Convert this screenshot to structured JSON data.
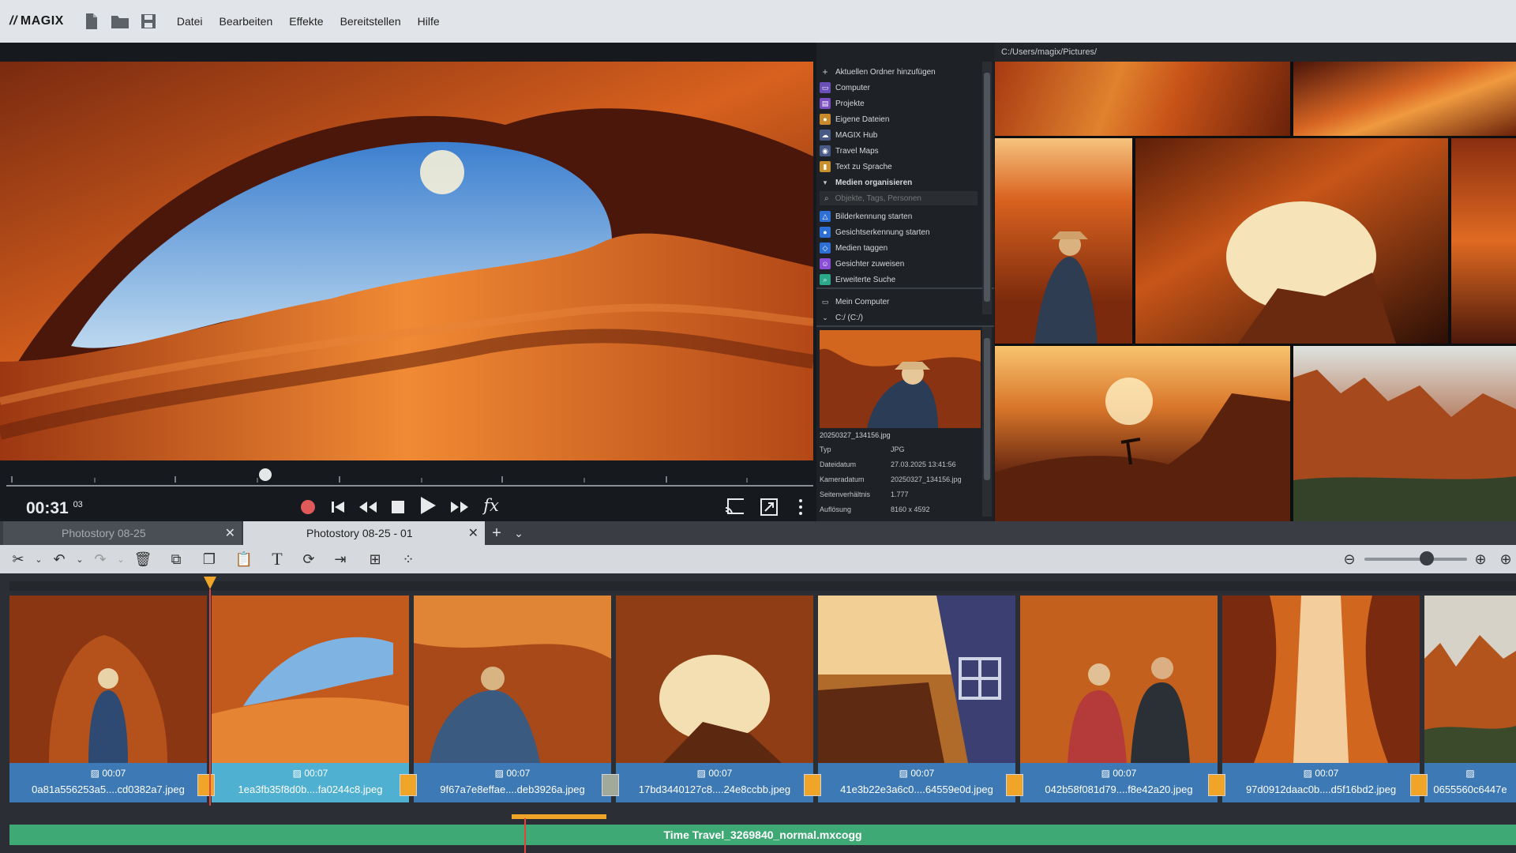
{
  "app": {
    "logo": "MAGIX"
  },
  "menu": [
    "Datei",
    "Bearbeiten",
    "Effekte",
    "Bereitstellen",
    "Hilfe"
  ],
  "player": {
    "time": "00:31",
    "frames": "03",
    "fx_label": "fx"
  },
  "browser": {
    "path": "C:/Users/magix/Pictures/",
    "items": [
      {
        "label": "Aktuellen Ordner hinzufügen",
        "icon": "plus-icon"
      },
      {
        "label": "Computer",
        "icon": "computer-icon"
      },
      {
        "label": "Projekte",
        "icon": "projects-icon"
      },
      {
        "label": "Eigene Dateien",
        "icon": "user-files-icon"
      },
      {
        "label": "MAGIX Hub",
        "icon": "cloud-icon"
      },
      {
        "label": "Travel Maps",
        "icon": "map-pin-icon"
      },
      {
        "label": "Text zu Sprache",
        "icon": "speech-icon"
      },
      {
        "label": "Medien organisieren",
        "icon": "chevron-down-icon"
      }
    ],
    "search_placeholder": "Objekte, Tags, Personen",
    "actions": [
      {
        "label": "Bilderkennung starten",
        "icon": "image-recognition-icon",
        "color": "#2e6fd6"
      },
      {
        "label": "Gesichtserkennung starten",
        "icon": "face-recognition-icon",
        "color": "#2e6fd6"
      },
      {
        "label": "Medien taggen",
        "icon": "tag-icon",
        "color": "#2e6fd6"
      },
      {
        "label": "Gesichter zuweisen",
        "icon": "assign-faces-icon",
        "color": "#8a4fd6"
      },
      {
        "label": "Erweiterte Suche",
        "icon": "advanced-search-icon",
        "color": "#2aa889"
      }
    ],
    "tree": {
      "mycomputer": "Mein Computer",
      "drive": "C:/ (C:/)"
    },
    "fileinfo": {
      "filename": "20250327_134156.jpg",
      "rows": [
        {
          "key": "Typ",
          "value": "JPG"
        },
        {
          "key": "Dateidatum",
          "value": "27.03.2025 13:41:56"
        },
        {
          "key": "Kameradatum",
          "value": "20250327_134156.jpg"
        },
        {
          "key": "Seitenverhältnis",
          "value": "1.777"
        },
        {
          "key": "Auflösung",
          "value": "8160 x 4592"
        }
      ]
    }
  },
  "tabs": [
    {
      "label": "Photostory 08-25"
    },
    {
      "label": "Photostory 08-25 - 01"
    }
  ],
  "timeline": {
    "clips": [
      {
        "duration": "00:07",
        "name": "0a81a556253a5....cd0382a7.jpeg",
        "bg": "#b5521c"
      },
      {
        "duration": "00:07",
        "name": "1ea3fb35f8d0b....fa0244c8.jpeg",
        "bg": "#c25a1d"
      },
      {
        "duration": "00:07",
        "name": "9f67a7e8effae....deb3926a.jpeg",
        "bg": "#a8491a"
      },
      {
        "duration": "00:07",
        "name": "17bd3440127c8....24e8ccbb.jpeg",
        "bg": "#8f3d14"
      },
      {
        "duration": "00:07",
        "name": "41e3b22e3a6c0....64559e0d.jpeg",
        "bg": "#b06a2a"
      },
      {
        "duration": "00:07",
        "name": "042b58f081d79....f8e42a20.jpeg",
        "bg": "#c4601e"
      },
      {
        "duration": "00:07",
        "name": "97d0912daac0b....d5f16bd2.jpeg",
        "bg": "#d1661f"
      },
      {
        "duration": "",
        "name": "0655560c6447e",
        "bg": "#b3541d"
      }
    ],
    "audio": "Time Travel_3269840_normal.mxcogg"
  }
}
